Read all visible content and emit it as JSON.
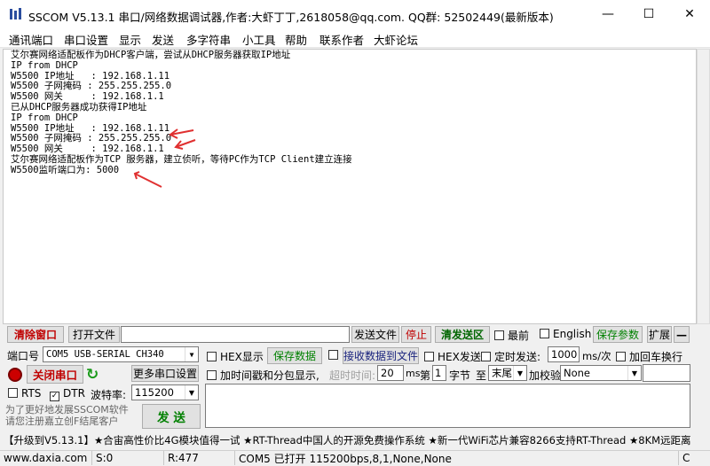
{
  "window": {
    "title": "SSCOM V5.13.1 串口/网络数据调试器,作者:大虾丁丁,2618058@qq.com. QQ群: 52502449(最新版本)",
    "minimize": "—",
    "maximize": "☐",
    "close": "✕"
  },
  "menu": [
    "通讯端口",
    "串口设置",
    "显示",
    "发送",
    "多字符串",
    "小工具",
    "帮助",
    "联系作者",
    "大虾论坛"
  ],
  "output_lines": [
    "艾尔赛网络适配板作为DHCP客户端，尝试从DHCP服务器获取IP地址",
    "IP from DHCP",
    "W5500 IP地址   : 192.168.1.11",
    "W5500 子网掩码 : 255.255.255.0",
    "W5500 网关     : 192.168.1.1",
    "已从DHCP服务器成功获得IP地址",
    "IP from DHCP",
    "W5500 IP地址   : 192.168.1.11",
    "W5500 子网掩码 : 255.255.255.0",
    "W5500 网关     : 192.168.1.1",
    "艾尔赛网络适配板作为TCP 服务器，建立侦听，等待PC作为TCP Client建立连接",
    "W5500监听端口为: 5000"
  ],
  "toolbar": {
    "clear_window": "清除窗口",
    "open_file": "打开文件",
    "send_file": "发送文件",
    "stop": "停止",
    "clear_send": "清发送区",
    "topmost": "最前",
    "english": "English",
    "save_params": "保存参数",
    "expand": "扩展",
    "collapse": "—"
  },
  "port": {
    "label": "端口号",
    "value": "COM5 USB-SERIAL CH340",
    "close_port": "关闭串口",
    "more_settings": "更多串口设置",
    "rts": "RTS",
    "dtr": "DTR",
    "baud_label": "波特率:",
    "baud": "115200",
    "promo": "为了更好地发展SSCOM软件\n请您注册嘉立创F结尾客户",
    "send": "发 送"
  },
  "options": {
    "hex_display": "HEX显示",
    "save_data": "保存数据",
    "recv_to_file": "接收数据到文件",
    "hex_send": "HEX发送",
    "timed_send": "定时发送:",
    "interval": "1000",
    "interval_unit": "ms/次",
    "add_crlf": "加回车换行",
    "timestamp": "加时间戳和分包显示,",
    "timeout_label": "超时时间:",
    "timeout": "20",
    "timeout_unit": "ms",
    "byte_prefix": "第",
    "byte_index": "1",
    "byte_suffix": "字节",
    "to": "至",
    "end": "末尾",
    "checksum_label": "加校验",
    "checksum": "None"
  },
  "marquee": "【升级到V5.13.1】★合宙高性价比4G模块值得一试 ★RT-Thread中国人的开源免费操作系统 ★新一代WiFi芯片兼容8266支持RT-Thread ★8KM远距离",
  "status": {
    "site": "www.daxia.com",
    "sent": "S:0",
    "received": "R:477",
    "port_state": "COM5 已打开  115200bps,8,1,None,None",
    "cts": "C"
  },
  "colors": {
    "arrow": "#e03030",
    "clear_text": "#c00000",
    "green_text": "#008000"
  }
}
